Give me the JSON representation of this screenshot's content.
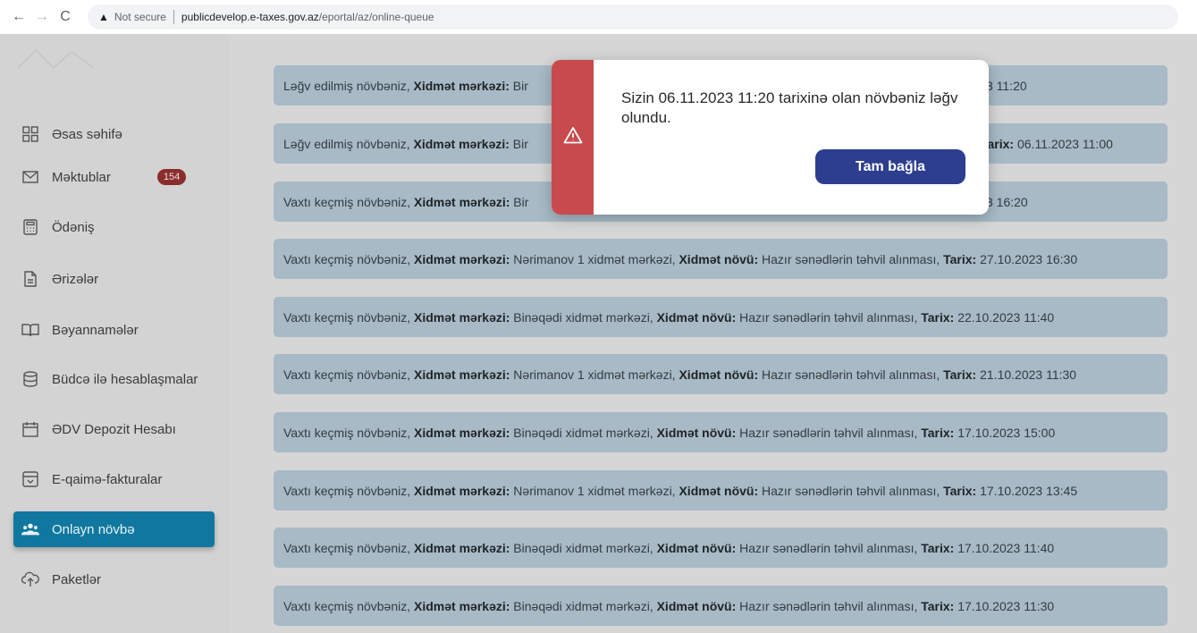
{
  "browser": {
    "back": "←",
    "forward": "→",
    "reload": "C",
    "security_label": "Not secure",
    "url_host": "publicdevelop.e-taxes.gov.az",
    "url_path": "/eportal/az/online-queue"
  },
  "sidebar": {
    "items": [
      {
        "label": "Əsas səhifə",
        "icon": "grid-icon"
      },
      {
        "label": "Məktublar",
        "icon": "envelope-icon",
        "badge": "154"
      },
      {
        "label": "Ödəniş",
        "icon": "calculator-icon"
      },
      {
        "label": "Ərizələr",
        "icon": "document-icon"
      },
      {
        "label": "Bəyannamələr",
        "icon": "book-icon"
      },
      {
        "label": "Büdcə ilə hesablaşmalar",
        "icon": "database-icon"
      },
      {
        "label": "ƏDV Depozit Hesabı",
        "icon": "calendar-icon"
      },
      {
        "label": "E-qaimə-fakturalar",
        "icon": "box-icon"
      },
      {
        "label": "Onlayn növbə",
        "icon": "users-icon",
        "active": true
      },
      {
        "label": "Paketlər",
        "icon": "cloud-upload-icon"
      }
    ]
  },
  "labels": {
    "center": "Xidmət mərkəzi:",
    "service": "Xidmət növü:",
    "date": "Tarix:"
  },
  "queue": [
    {
      "status": "Ləğv edilmiş növbəniz,",
      "center": "Bir",
      "tail": "3 11:20"
    },
    {
      "status": "Ləğv edilmiş növbəniz,",
      "center": "Bir",
      "tail_date": "06.11.2023 11:00"
    },
    {
      "status": "Vaxtı keçmiş növbəniz,",
      "center": "Bir",
      "tail": "3 16:20"
    },
    {
      "status": "Vaxtı keçmiş növbəniz,",
      "center": "Nərimanov 1 xidmət mərkəzi,",
      "service": "Hazır sənədlərin təhvil alınması,",
      "date": "27.10.2023 16:30"
    },
    {
      "status": "Vaxtı keçmiş növbəniz,",
      "center": "Binəqədi xidmət mərkəzi,",
      "service": "Hazır sənədlərin təhvil alınması,",
      "date": "22.10.2023 11:40"
    },
    {
      "status": "Vaxtı keçmiş növbəniz,",
      "center": "Nərimanov 1 xidmət mərkəzi,",
      "service": "Hazır sənədlərin təhvil alınması,",
      "date": "21.10.2023 11:30"
    },
    {
      "status": "Vaxtı keçmiş növbəniz,",
      "center": "Binəqədi xidmət mərkəzi,",
      "service": "Hazır sənədlərin təhvil alınması,",
      "date": "17.10.2023 15:00"
    },
    {
      "status": "Vaxtı keçmiş növbəniz,",
      "center": "Nərimanov 1 xidmət mərkəzi,",
      "service": "Hazır sənədlərin təhvil alınması,",
      "date": "17.10.2023 13:45"
    },
    {
      "status": "Vaxtı keçmiş növbəniz,",
      "center": "Binəqədi xidmət mərkəzi,",
      "service": "Hazır sənədlərin təhvil alınması,",
      "date": "17.10.2023 11:40"
    },
    {
      "status": "Vaxtı keçmiş növbəniz,",
      "center": "Binəqədi xidmət mərkəzi,",
      "service": "Hazır sənədlərin təhvil alınması,",
      "date": "17.10.2023 11:30"
    }
  ],
  "modal": {
    "message": "Sizin 06.11.2023 11:20 tarixinə olan növbəniz ləğv olundu.",
    "button": "Tam bağla",
    "icon": "warning-icon"
  },
  "colors": {
    "active_nav": "#10789f",
    "badge": "#8a2d2d",
    "modal_strip": "#c94a4c",
    "modal_button": "#2d3e8f",
    "queue_item": "#a7bac6"
  }
}
